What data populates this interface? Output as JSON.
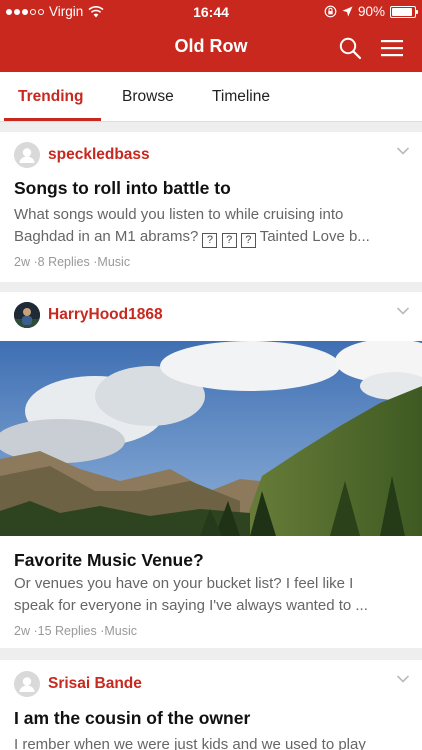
{
  "status": {
    "carrier": "Virgin",
    "time": "16:44",
    "battery": "90%",
    "battery_level": 0.9
  },
  "nav": {
    "title": "Old Row",
    "search_icon": "search-icon",
    "menu_icon": "hamburger-menu-icon"
  },
  "tabs": [
    {
      "label": "Trending",
      "active": true
    },
    {
      "label": "Browse",
      "active": false
    },
    {
      "label": "Timeline",
      "active": false
    }
  ],
  "posts": [
    {
      "author": "speckledbass",
      "title": "Songs to roll into battle to",
      "excerpt_line1": "What songs would you listen to while cruising into",
      "excerpt_line2_start": "Baghdad in an M1 abrams?",
      "missing_glyph": "?",
      "excerpt_line2_end": "Tainted Love b...",
      "age": "2w",
      "replies": "8 Replies",
      "category": "Music"
    },
    {
      "author": "HarryHood1868",
      "title": "Favorite Music Venue?",
      "excerpt_line1": "Or venues you have on your bucket list? I feel like I",
      "excerpt_line2": "speak for everyone in saying I've always wanted to ...",
      "age": "2w",
      "replies": "15 Replies",
      "category": "Music"
    },
    {
      "author": "Srisai Bande",
      "title": "I am the cousin of the owner",
      "excerpt_line1": "I rember when we were just kids and we used to play"
    }
  ],
  "separator": "·",
  "colors": {
    "brand": "#c8281e",
    "background": "#eeeeee",
    "meta": "#999999"
  }
}
